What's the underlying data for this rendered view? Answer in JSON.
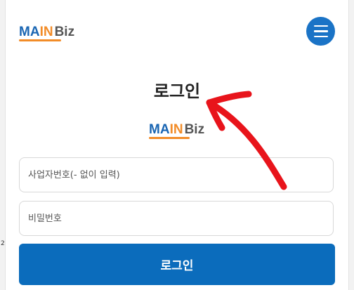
{
  "header": {
    "logo": {
      "part1": "MA",
      "part2": "IN",
      "part3": "Biz"
    },
    "menu_icon": "hamburger-icon"
  },
  "page": {
    "title": "로그인",
    "logo": {
      "part1": "MA",
      "part2": "IN",
      "part3": "Biz"
    }
  },
  "form": {
    "id_placeholder": "사업자번호(- 없이 입력)",
    "password_placeholder": "비밀번호",
    "submit_label": "로그인"
  },
  "colors": {
    "brand_blue": "#1a66b3",
    "brand_orange": "#f28c28",
    "button_blue": "#0b6cbc",
    "annotation_red": "#e8141b"
  }
}
